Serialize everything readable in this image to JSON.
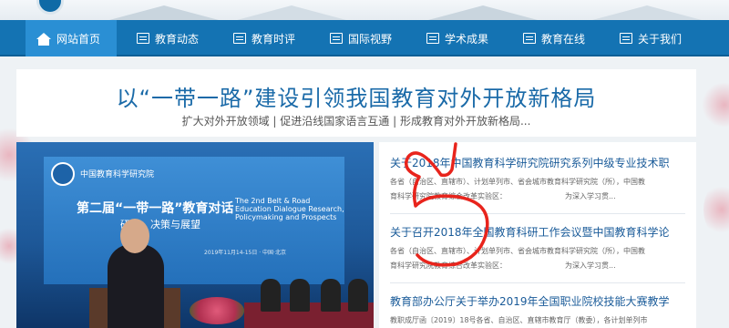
{
  "nav": {
    "items": [
      {
        "label": "网站首页",
        "icon": "home-icon",
        "active": true
      },
      {
        "label": "教育动态",
        "icon": "news-icon",
        "active": false
      },
      {
        "label": "教育时评",
        "icon": "news-icon",
        "active": false
      },
      {
        "label": "国际视野",
        "icon": "news-icon",
        "active": false
      },
      {
        "label": "学术成果",
        "icon": "news-icon",
        "active": false
      },
      {
        "label": "教育在线",
        "icon": "news-icon",
        "active": false
      },
      {
        "label": "关于我们",
        "icon": "news-icon",
        "active": false
      }
    ]
  },
  "headline": {
    "title": "以“一带一路”建设引领我国教育对外开放新格局",
    "subtitle": "扩大对外开放领域 | 促进沿线国家语言互通 | 形成教育对外开放新格局..."
  },
  "photo": {
    "org_text": "中国教育科学研究院",
    "title": "第二届“一带一路”教育对话",
    "subtitle": "研究、决策与展望",
    "english": "The 2nd Belt & Road Education Dialogue Research, Policymaking and Prospects",
    "date": "2019年11月14-15日 · 中国·北京"
  },
  "news": [
    {
      "title": "关于2018年中国教育科学研究院研究系列中级专业技术职",
      "summary_line1": "各省（自治区、直辖市）、计划单列市、省会城市教育科学研究院（所），中国教",
      "summary_line2_left": "育科学研究院教育综合改革实验区：",
      "summary_line2_right": "为深入学习贯..."
    },
    {
      "title": "关于召开2018年全国教育科研工作会议暨中国教育科学论",
      "summary_line1": "各省（自治区、直辖市）、计划单列市、省会城市教育科学研究院（所），中国教",
      "summary_line2_left": "育科学研究院教育综合改革实验区：",
      "summary_line2_right": "为深入学习贯..."
    },
    {
      "title": "教育部办公厅关于举办2019年全国职业院校技能大赛教学",
      "summary_line1": "教职成厅函〔2019〕18号各省、自治区、直辖市教育厅（教委），各计划单列市",
      "summary_line2_left": "",
      "summary_line2_right": ""
    }
  ],
  "colors": {
    "nav_bg": "#1473b3",
    "nav_active": "#2a8fd4",
    "headline": "#1a6aa8",
    "link": "#1a5b99",
    "annotation": "#e8241c"
  }
}
